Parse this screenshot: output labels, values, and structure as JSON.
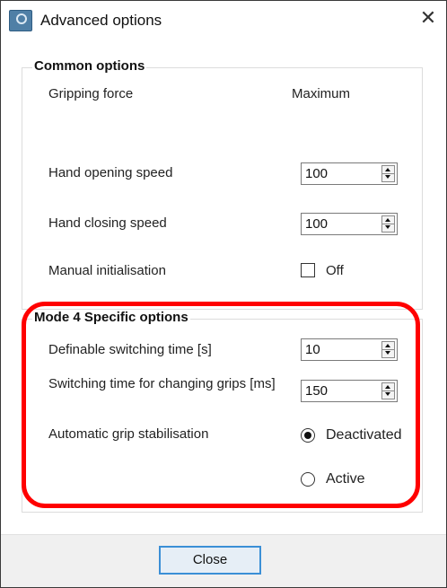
{
  "window": {
    "title": "Advanced options",
    "close_glyph": "✕"
  },
  "common": {
    "group_title": "Common options",
    "gripping_force_label": "Gripping force",
    "gripping_force_value": "Maximum",
    "opening_speed_label": "Hand opening speed",
    "opening_speed_value": "100",
    "closing_speed_label": "Hand closing speed",
    "closing_speed_value": "100",
    "manual_init_label": "Manual initialisation",
    "manual_init_state": "Off"
  },
  "mode4": {
    "group_title": "Mode 4 Specific options",
    "switching_time_label": "Definable switching time [s]",
    "switching_time_value": "10",
    "changing_grips_label": "Switching time for changing grips [ms]",
    "changing_grips_value": "150",
    "stabilisation_label": "Automatic grip stabilisation",
    "options": [
      "Deactivated",
      "Active"
    ],
    "selected_option": "Deactivated"
  },
  "footer": {
    "close_label": "Close"
  },
  "colors": {
    "annotation_outline": "#ff0000",
    "button_focus_border": "#3b8fd6"
  }
}
